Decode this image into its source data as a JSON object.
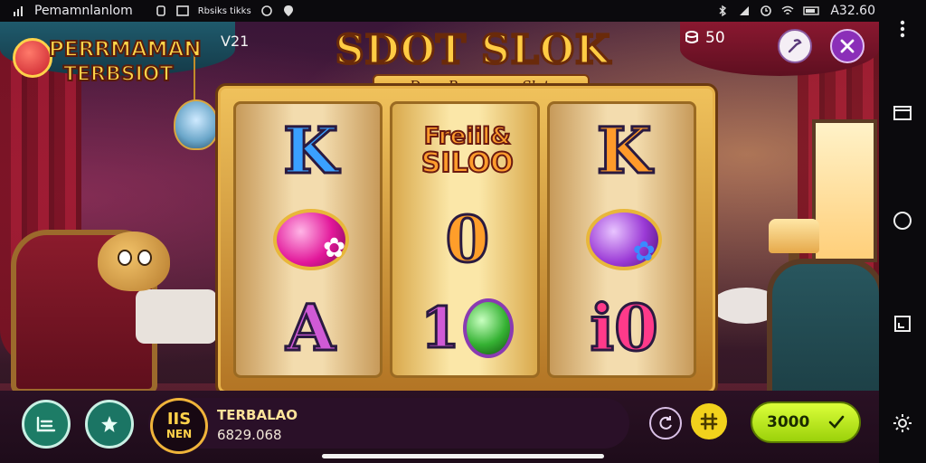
{
  "status_bar": {
    "app_name": "Pemamnlanlom",
    "notif_tag": "Rbsiks tikks",
    "time": "A32.60"
  },
  "game": {
    "logo_line1": "PERRMAMAN",
    "logo_line2": "TERBSIOT",
    "version": "V21",
    "title": "SDOT SLOK",
    "subtitle": "Daur Pengemar Slot",
    "coins_icon": "coin-stack-icon",
    "coins": "50"
  },
  "reels": [
    [
      {
        "kind": "letter",
        "text": "K",
        "style": "k-blue"
      },
      {
        "kind": "gem",
        "color": "pink"
      },
      {
        "kind": "letter",
        "text": "A",
        "style": "a-purple"
      }
    ],
    [
      {
        "kind": "word",
        "line1": "Freiil&",
        "line2": "SILOO"
      },
      {
        "kind": "letter",
        "text": "0",
        "style": "zero-orange"
      },
      {
        "kind": "plaque",
        "text": "1"
      }
    ],
    [
      {
        "kind": "letter",
        "text": "K",
        "style": "k-orange"
      },
      {
        "kind": "gem",
        "color": "violet"
      },
      {
        "kind": "letter",
        "text": "i0",
        "style": "io-pink"
      }
    ]
  ],
  "jackpot": {
    "badge_line1": "IIS",
    "badge_line2": "NEN",
    "label": "TERBALAO",
    "value": "6829.068"
  },
  "spin": {
    "value": "3000",
    "arrow": "✓"
  },
  "colors": {
    "accent_gold": "#ffcc44",
    "spin_green": "#c8f01e",
    "stage_purple": "#4c1d3c"
  }
}
